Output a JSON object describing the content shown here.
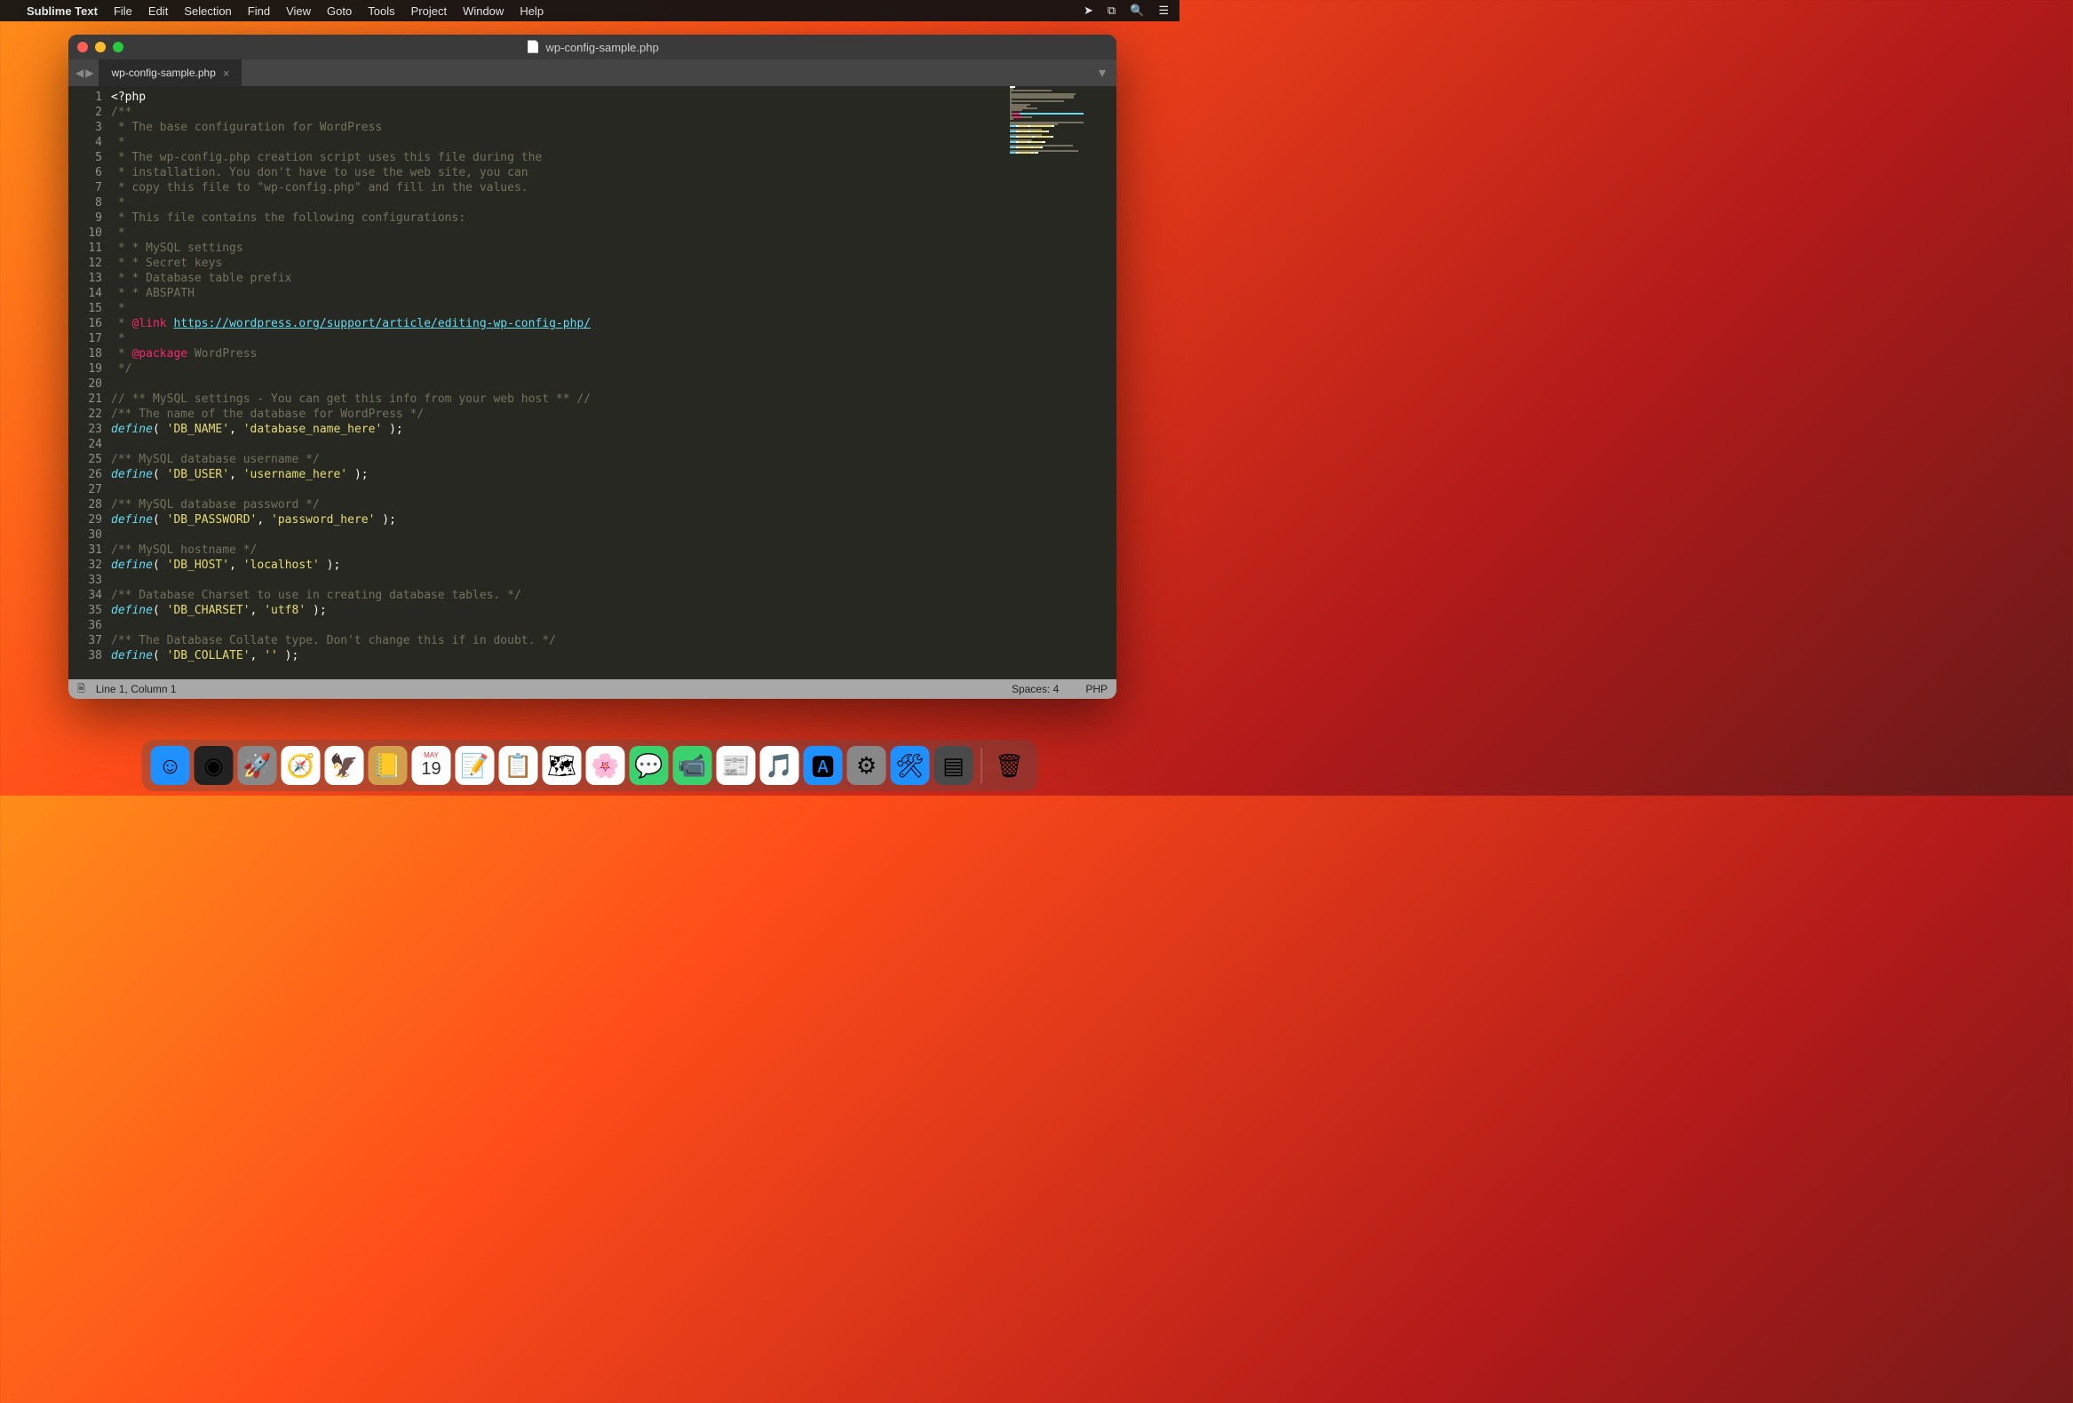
{
  "menubar": {
    "app_name": "Sublime Text",
    "items": [
      "File",
      "Edit",
      "Selection",
      "Find",
      "View",
      "Goto",
      "Tools",
      "Project",
      "Window",
      "Help"
    ]
  },
  "window": {
    "title": "wp-config-sample.php"
  },
  "tab": {
    "label": "wp-config-sample.php"
  },
  "code": {
    "lines": [
      [
        {
          "c": "c-pun",
          "t": "<?php"
        }
      ],
      [
        {
          "c": "c-com",
          "t": "/**"
        }
      ],
      [
        {
          "c": "c-com",
          "t": " * The base configuration for WordPress"
        }
      ],
      [
        {
          "c": "c-com",
          "t": " *"
        }
      ],
      [
        {
          "c": "c-com",
          "t": " * The wp-config.php creation script uses this file during the"
        }
      ],
      [
        {
          "c": "c-com",
          "t": " * installation. You don't have to use the web site, you can"
        }
      ],
      [
        {
          "c": "c-com",
          "t": " * copy this file to \"wp-config.php\" and fill in the values."
        }
      ],
      [
        {
          "c": "c-com",
          "t": " *"
        }
      ],
      [
        {
          "c": "c-com",
          "t": " * This file contains the following configurations:"
        }
      ],
      [
        {
          "c": "c-com",
          "t": " *"
        }
      ],
      [
        {
          "c": "c-com",
          "t": " * * MySQL settings"
        }
      ],
      [
        {
          "c": "c-com",
          "t": " * * Secret keys"
        }
      ],
      [
        {
          "c": "c-com",
          "t": " * * Database table prefix"
        }
      ],
      [
        {
          "c": "c-com",
          "t": " * * ABSPATH"
        }
      ],
      [
        {
          "c": "c-com",
          "t": " *"
        }
      ],
      [
        {
          "c": "c-com",
          "t": " * "
        },
        {
          "c": "c-doc",
          "t": "@link"
        },
        {
          "c": "c-com",
          "t": " "
        },
        {
          "c": "c-link",
          "t": "https://wordpress.org/support/article/editing-wp-config-php/"
        }
      ],
      [
        {
          "c": "c-com",
          "t": " *"
        }
      ],
      [
        {
          "c": "c-com",
          "t": " * "
        },
        {
          "c": "c-doc",
          "t": "@package"
        },
        {
          "c": "c-com",
          "t": " WordPress"
        }
      ],
      [
        {
          "c": "c-com",
          "t": " */"
        }
      ],
      [
        {
          "c": "",
          "t": ""
        }
      ],
      [
        {
          "c": "c-com",
          "t": "// ** MySQL settings - You can get this info from your web host ** //"
        }
      ],
      [
        {
          "c": "c-com",
          "t": "/** The name of the database for WordPress */"
        }
      ],
      [
        {
          "c": "c-key",
          "t": "define"
        },
        {
          "c": "c-pun",
          "t": "( "
        },
        {
          "c": "c-str",
          "t": "'DB_NAME'"
        },
        {
          "c": "c-pun",
          "t": ", "
        },
        {
          "c": "c-str",
          "t": "'database_name_here'"
        },
        {
          "c": "c-pun",
          "t": " );"
        }
      ],
      [
        {
          "c": "",
          "t": ""
        }
      ],
      [
        {
          "c": "c-com",
          "t": "/** MySQL database username */"
        }
      ],
      [
        {
          "c": "c-key",
          "t": "define"
        },
        {
          "c": "c-pun",
          "t": "( "
        },
        {
          "c": "c-str",
          "t": "'DB_USER'"
        },
        {
          "c": "c-pun",
          "t": ", "
        },
        {
          "c": "c-str",
          "t": "'username_here'"
        },
        {
          "c": "c-pun",
          "t": " );"
        }
      ],
      [
        {
          "c": "",
          "t": ""
        }
      ],
      [
        {
          "c": "c-com",
          "t": "/** MySQL database password */"
        }
      ],
      [
        {
          "c": "c-key",
          "t": "define"
        },
        {
          "c": "c-pun",
          "t": "( "
        },
        {
          "c": "c-str",
          "t": "'DB_PASSWORD'"
        },
        {
          "c": "c-pun",
          "t": ", "
        },
        {
          "c": "c-str",
          "t": "'password_here'"
        },
        {
          "c": "c-pun",
          "t": " );"
        }
      ],
      [
        {
          "c": "",
          "t": ""
        }
      ],
      [
        {
          "c": "c-com",
          "t": "/** MySQL hostname */"
        }
      ],
      [
        {
          "c": "c-key",
          "t": "define"
        },
        {
          "c": "c-pun",
          "t": "( "
        },
        {
          "c": "c-str",
          "t": "'DB_HOST'"
        },
        {
          "c": "c-pun",
          "t": ", "
        },
        {
          "c": "c-str",
          "t": "'localhost'"
        },
        {
          "c": "c-pun",
          "t": " );"
        }
      ],
      [
        {
          "c": "",
          "t": ""
        }
      ],
      [
        {
          "c": "c-com",
          "t": "/** Database Charset to use in creating database tables. */"
        }
      ],
      [
        {
          "c": "c-key",
          "t": "define"
        },
        {
          "c": "c-pun",
          "t": "( "
        },
        {
          "c": "c-str",
          "t": "'DB_CHARSET'"
        },
        {
          "c": "c-pun",
          "t": ", "
        },
        {
          "c": "c-str",
          "t": "'utf8'"
        },
        {
          "c": "c-pun",
          "t": " );"
        }
      ],
      [
        {
          "c": "",
          "t": ""
        }
      ],
      [
        {
          "c": "c-com",
          "t": "/** The Database Collate type. Don't change this if in doubt. */"
        }
      ],
      [
        {
          "c": "c-key",
          "t": "define"
        },
        {
          "c": "c-pun",
          "t": "( "
        },
        {
          "c": "c-str",
          "t": "'DB_COLLATE'"
        },
        {
          "c": "c-pun",
          "t": ", "
        },
        {
          "c": "c-str",
          "t": "''"
        },
        {
          "c": "c-pun",
          "t": " );"
        }
      ]
    ]
  },
  "statusbar": {
    "position": "Line 1, Column 1",
    "spaces": "Spaces: 4",
    "lang": "PHP"
  },
  "dock": {
    "items": [
      {
        "name": "finder",
        "bg": "#1e90ff",
        "glyph": "☺"
      },
      {
        "name": "siri",
        "bg": "#222",
        "glyph": "◉"
      },
      {
        "name": "launchpad",
        "bg": "#888",
        "glyph": "🚀"
      },
      {
        "name": "safari",
        "bg": "#fff",
        "glyph": "🧭"
      },
      {
        "name": "mail",
        "bg": "#fff",
        "glyph": "🦅"
      },
      {
        "name": "contacts",
        "bg": "#d2a04d",
        "glyph": "📒"
      },
      {
        "name": "calendar",
        "bg": "#fff",
        "glyph": "📅"
      },
      {
        "name": "notes",
        "bg": "#fff",
        "glyph": "📝"
      },
      {
        "name": "reminders",
        "bg": "#fff",
        "glyph": "📋"
      },
      {
        "name": "maps",
        "bg": "#fff",
        "glyph": "🗺"
      },
      {
        "name": "photos",
        "bg": "#fff",
        "glyph": "🌸"
      },
      {
        "name": "messages",
        "bg": "#3bd16f",
        "glyph": "💬"
      },
      {
        "name": "facetime",
        "bg": "#3bd16f",
        "glyph": "📹"
      },
      {
        "name": "news",
        "bg": "#fff",
        "glyph": "📰"
      },
      {
        "name": "music",
        "bg": "#fff",
        "glyph": "🎵"
      },
      {
        "name": "appstore",
        "bg": "#1e90ff",
        "glyph": "🅰"
      },
      {
        "name": "settings",
        "bg": "#888",
        "glyph": "⚙"
      },
      {
        "name": "xcode",
        "bg": "#1e90ff",
        "glyph": "🛠"
      },
      {
        "name": "sublime",
        "bg": "#4a4a4a",
        "glyph": "▤"
      }
    ],
    "trash_glyph": "🗑"
  },
  "calendar": {
    "month": "MAY",
    "day": "19"
  }
}
